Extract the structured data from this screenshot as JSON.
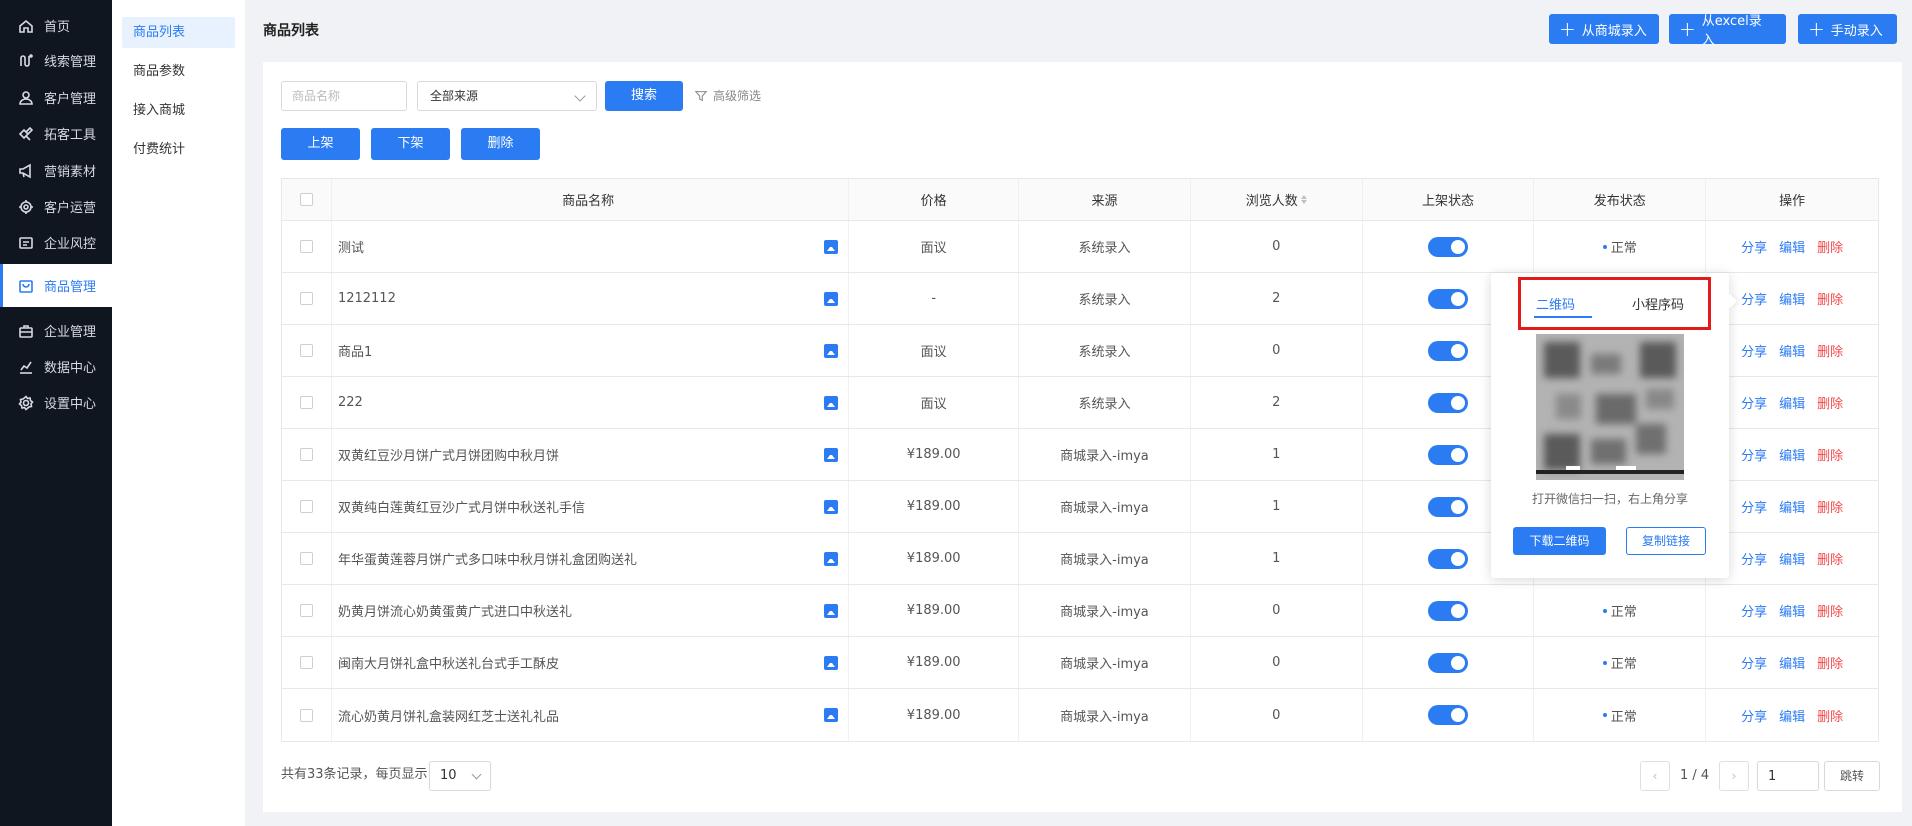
{
  "nav": {
    "items": [
      {
        "label": "首页",
        "icon": "home-icon"
      },
      {
        "label": "线索管理",
        "icon": "leads-icon"
      },
      {
        "label": "客户管理",
        "icon": "customer-icon"
      },
      {
        "label": "拓客工具",
        "icon": "tools-icon"
      },
      {
        "label": "营销素材",
        "icon": "megaphone-icon"
      },
      {
        "label": "客户运营",
        "icon": "operations-icon"
      },
      {
        "label": "企业风控",
        "icon": "risk-icon"
      },
      {
        "label": "商品管理",
        "icon": "product-icon"
      },
      {
        "label": "企业管理",
        "icon": "enterprise-icon"
      },
      {
        "label": "数据中心",
        "icon": "chart-icon"
      },
      {
        "label": "设置中心",
        "icon": "settings-icon"
      }
    ],
    "active_index": 7
  },
  "subnav": {
    "items": [
      "商品列表",
      "商品参数",
      "接入商城",
      "付费统计"
    ],
    "active_index": 0
  },
  "header": {
    "title": "商品列表",
    "buttons": [
      "从商城录入",
      "从excel录入",
      "手动录入"
    ]
  },
  "filters": {
    "name_placeholder": "商品名称",
    "source_value": "全部来源",
    "search_label": "搜索",
    "advanced_label": "高级筛选"
  },
  "actions": {
    "on_shelf": "上架",
    "off_shelf": "下架",
    "delete": "删除"
  },
  "table": {
    "columns": [
      "商品名称",
      "价格",
      "来源",
      "浏览人数",
      "上架状态",
      "发布状态",
      "操作"
    ],
    "ops": {
      "share": "分享",
      "edit": "编辑",
      "delete": "删除"
    },
    "rows": [
      {
        "name": "测试",
        "price": "面议",
        "source": "系统录入",
        "views": "0",
        "on_shelf": true,
        "publish": "正常"
      },
      {
        "name": "1212112",
        "price": "-",
        "source": "系统录入",
        "views": "2",
        "on_shelf": true,
        "publish": ""
      },
      {
        "name": "商品1",
        "price": "面议",
        "source": "系统录入",
        "views": "0",
        "on_shelf": true,
        "publish": ""
      },
      {
        "name": "222",
        "price": "面议",
        "source": "系统录入",
        "views": "2",
        "on_shelf": true,
        "publish": ""
      },
      {
        "name": "双黄红豆沙月饼广式月饼团购中秋月饼",
        "price": "¥189.00",
        "source": "商城录入-imya",
        "views": "1",
        "on_shelf": true,
        "publish": ""
      },
      {
        "name": "双黄纯白莲黄红豆沙广式月饼中秋送礼手信",
        "price": "¥189.00",
        "source": "商城录入-imya",
        "views": "1",
        "on_shelf": true,
        "publish": ""
      },
      {
        "name": "年华蛋黄莲蓉月饼广式多口味中秋月饼礼盒团购送礼",
        "price": "¥189.00",
        "source": "商城录入-imya",
        "views": "1",
        "on_shelf": true,
        "publish": ""
      },
      {
        "name": "奶黄月饼流心奶黄蛋黄广式进口中秋送礼",
        "price": "¥189.00",
        "source": "商城录入-imya",
        "views": "0",
        "on_shelf": true,
        "publish": "正常"
      },
      {
        "name": "闽南大月饼礼盒中秋送礼台式手工酥皮",
        "price": "¥189.00",
        "source": "商城录入-imya",
        "views": "0",
        "on_shelf": true,
        "publish": "正常"
      },
      {
        "name": "流心奶黄月饼礼盒装网红芝士送礼礼品",
        "price": "¥189.00",
        "source": "商城录入-imya",
        "views": "0",
        "on_shelf": true,
        "publish": "正常"
      }
    ]
  },
  "pagination": {
    "total_text": "共有33条记录，每页显示",
    "page_size": "10",
    "page_text": "1 / 4",
    "page_input": "1",
    "jump_label": "跳转"
  },
  "popover": {
    "tab_qr": "二维码",
    "tab_mini": "小程序码",
    "hint": "打开微信扫一扫，右上角分享",
    "download_label": "下载二维码",
    "copy_label": "复制链接"
  },
  "colors": {
    "primary": "#2b7bf3",
    "danger": "#f5484a",
    "nav_bg": "#0f1620",
    "highlight_box": "#e21a1a"
  }
}
